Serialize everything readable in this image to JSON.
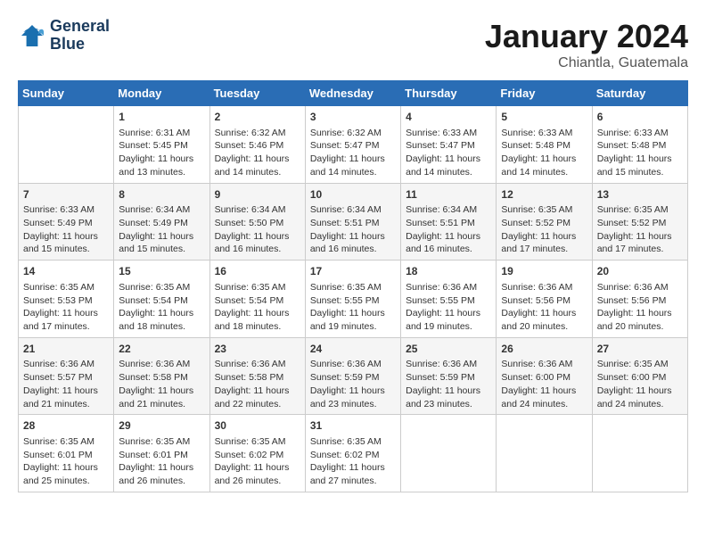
{
  "logo": {
    "name_line1": "General",
    "name_line2": "Blue"
  },
  "title": "January 2024",
  "subtitle": "Chiantla, Guatemala",
  "days_of_week": [
    "Sunday",
    "Monday",
    "Tuesday",
    "Wednesday",
    "Thursday",
    "Friday",
    "Saturday"
  ],
  "weeks": [
    [
      {
        "day": "",
        "sunrise": "",
        "sunset": "",
        "daylight": ""
      },
      {
        "day": "1",
        "sunrise": "Sunrise: 6:31 AM",
        "sunset": "Sunset: 5:45 PM",
        "daylight": "Daylight: 11 hours and 13 minutes."
      },
      {
        "day": "2",
        "sunrise": "Sunrise: 6:32 AM",
        "sunset": "Sunset: 5:46 PM",
        "daylight": "Daylight: 11 hours and 14 minutes."
      },
      {
        "day": "3",
        "sunrise": "Sunrise: 6:32 AM",
        "sunset": "Sunset: 5:47 PM",
        "daylight": "Daylight: 11 hours and 14 minutes."
      },
      {
        "day": "4",
        "sunrise": "Sunrise: 6:33 AM",
        "sunset": "Sunset: 5:47 PM",
        "daylight": "Daylight: 11 hours and 14 minutes."
      },
      {
        "day": "5",
        "sunrise": "Sunrise: 6:33 AM",
        "sunset": "Sunset: 5:48 PM",
        "daylight": "Daylight: 11 hours and 14 minutes."
      },
      {
        "day": "6",
        "sunrise": "Sunrise: 6:33 AM",
        "sunset": "Sunset: 5:48 PM",
        "daylight": "Daylight: 11 hours and 15 minutes."
      }
    ],
    [
      {
        "day": "7",
        "sunrise": "Sunrise: 6:33 AM",
        "sunset": "Sunset: 5:49 PM",
        "daylight": "Daylight: 11 hours and 15 minutes."
      },
      {
        "day": "8",
        "sunrise": "Sunrise: 6:34 AM",
        "sunset": "Sunset: 5:49 PM",
        "daylight": "Daylight: 11 hours and 15 minutes."
      },
      {
        "day": "9",
        "sunrise": "Sunrise: 6:34 AM",
        "sunset": "Sunset: 5:50 PM",
        "daylight": "Daylight: 11 hours and 16 minutes."
      },
      {
        "day": "10",
        "sunrise": "Sunrise: 6:34 AM",
        "sunset": "Sunset: 5:51 PM",
        "daylight": "Daylight: 11 hours and 16 minutes."
      },
      {
        "day": "11",
        "sunrise": "Sunrise: 6:34 AM",
        "sunset": "Sunset: 5:51 PM",
        "daylight": "Daylight: 11 hours and 16 minutes."
      },
      {
        "day": "12",
        "sunrise": "Sunrise: 6:35 AM",
        "sunset": "Sunset: 5:52 PM",
        "daylight": "Daylight: 11 hours and 17 minutes."
      },
      {
        "day": "13",
        "sunrise": "Sunrise: 6:35 AM",
        "sunset": "Sunset: 5:52 PM",
        "daylight": "Daylight: 11 hours and 17 minutes."
      }
    ],
    [
      {
        "day": "14",
        "sunrise": "Sunrise: 6:35 AM",
        "sunset": "Sunset: 5:53 PM",
        "daylight": "Daylight: 11 hours and 17 minutes."
      },
      {
        "day": "15",
        "sunrise": "Sunrise: 6:35 AM",
        "sunset": "Sunset: 5:54 PM",
        "daylight": "Daylight: 11 hours and 18 minutes."
      },
      {
        "day": "16",
        "sunrise": "Sunrise: 6:35 AM",
        "sunset": "Sunset: 5:54 PM",
        "daylight": "Daylight: 11 hours and 18 minutes."
      },
      {
        "day": "17",
        "sunrise": "Sunrise: 6:35 AM",
        "sunset": "Sunset: 5:55 PM",
        "daylight": "Daylight: 11 hours and 19 minutes."
      },
      {
        "day": "18",
        "sunrise": "Sunrise: 6:36 AM",
        "sunset": "Sunset: 5:55 PM",
        "daylight": "Daylight: 11 hours and 19 minutes."
      },
      {
        "day": "19",
        "sunrise": "Sunrise: 6:36 AM",
        "sunset": "Sunset: 5:56 PM",
        "daylight": "Daylight: 11 hours and 20 minutes."
      },
      {
        "day": "20",
        "sunrise": "Sunrise: 6:36 AM",
        "sunset": "Sunset: 5:56 PM",
        "daylight": "Daylight: 11 hours and 20 minutes."
      }
    ],
    [
      {
        "day": "21",
        "sunrise": "Sunrise: 6:36 AM",
        "sunset": "Sunset: 5:57 PM",
        "daylight": "Daylight: 11 hours and 21 minutes."
      },
      {
        "day": "22",
        "sunrise": "Sunrise: 6:36 AM",
        "sunset": "Sunset: 5:58 PM",
        "daylight": "Daylight: 11 hours and 21 minutes."
      },
      {
        "day": "23",
        "sunrise": "Sunrise: 6:36 AM",
        "sunset": "Sunset: 5:58 PM",
        "daylight": "Daylight: 11 hours and 22 minutes."
      },
      {
        "day": "24",
        "sunrise": "Sunrise: 6:36 AM",
        "sunset": "Sunset: 5:59 PM",
        "daylight": "Daylight: 11 hours and 23 minutes."
      },
      {
        "day": "25",
        "sunrise": "Sunrise: 6:36 AM",
        "sunset": "Sunset: 5:59 PM",
        "daylight": "Daylight: 11 hours and 23 minutes."
      },
      {
        "day": "26",
        "sunrise": "Sunrise: 6:36 AM",
        "sunset": "Sunset: 6:00 PM",
        "daylight": "Daylight: 11 hours and 24 minutes."
      },
      {
        "day": "27",
        "sunrise": "Sunrise: 6:35 AM",
        "sunset": "Sunset: 6:00 PM",
        "daylight": "Daylight: 11 hours and 24 minutes."
      }
    ],
    [
      {
        "day": "28",
        "sunrise": "Sunrise: 6:35 AM",
        "sunset": "Sunset: 6:01 PM",
        "daylight": "Daylight: 11 hours and 25 minutes."
      },
      {
        "day": "29",
        "sunrise": "Sunrise: 6:35 AM",
        "sunset": "Sunset: 6:01 PM",
        "daylight": "Daylight: 11 hours and 26 minutes."
      },
      {
        "day": "30",
        "sunrise": "Sunrise: 6:35 AM",
        "sunset": "Sunset: 6:02 PM",
        "daylight": "Daylight: 11 hours and 26 minutes."
      },
      {
        "day": "31",
        "sunrise": "Sunrise: 6:35 AM",
        "sunset": "Sunset: 6:02 PM",
        "daylight": "Daylight: 11 hours and 27 minutes."
      },
      {
        "day": "",
        "sunrise": "",
        "sunset": "",
        "daylight": ""
      },
      {
        "day": "",
        "sunrise": "",
        "sunset": "",
        "daylight": ""
      },
      {
        "day": "",
        "sunrise": "",
        "sunset": "",
        "daylight": ""
      }
    ]
  ]
}
